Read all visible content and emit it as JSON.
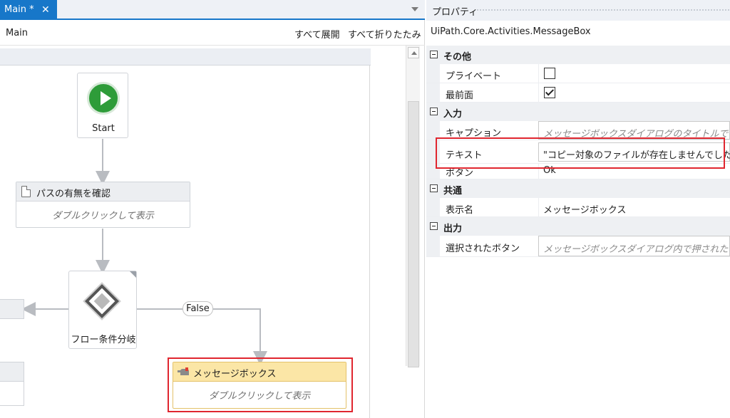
{
  "designer": {
    "tab": {
      "label": "Main *",
      "close": "✕"
    },
    "breadcrumb": "Main",
    "expand_all": "すべて展開",
    "collapse_all": "すべて折りたたみ",
    "nodes": {
      "start": "Start",
      "check_path": {
        "title": "パスの有無を確認",
        "body": "ダブルクリックして表示"
      },
      "decision": "フロー条件分岐",
      "false_label": "False",
      "message_box": {
        "title": "メッセージボックス",
        "body": "ダブルクリックして表示"
      }
    }
  },
  "properties": {
    "title": "プロパティ",
    "class_name": "UiPath.Core.Activities.MessageBox",
    "categories": [
      {
        "label": "その他",
        "rows": [
          {
            "name": "プライベート",
            "type": "checkbox",
            "checked": false
          },
          {
            "name": "最前面",
            "type": "checkbox",
            "checked": true
          }
        ]
      },
      {
        "label": "入力",
        "rows": [
          {
            "name": "キャプション",
            "value": "メッセージボックスダイアログのタイトルです。",
            "placeholder": true
          },
          {
            "name": "テキスト",
            "value": "\"コピー対象のファイルが存在しませんでした\"",
            "placeholder": false
          },
          {
            "name": "ボタン",
            "value": "Ok",
            "placeholder": false
          }
        ]
      },
      {
        "label": "共通",
        "rows": [
          {
            "name": "表示名",
            "value": "メッセージボックス",
            "placeholder": false
          }
        ]
      },
      {
        "label": "出力",
        "rows": [
          {
            "name": "選択されたボタン",
            "value": "メッセージボックスダイアログ内で押されたボタン",
            "placeholder": true
          }
        ]
      }
    ]
  },
  "colors": {
    "accent": "#1777c9",
    "start_green": "#2e9c39",
    "highlight_red": "#e0262f",
    "message_box_header": "#fbe6a6"
  }
}
